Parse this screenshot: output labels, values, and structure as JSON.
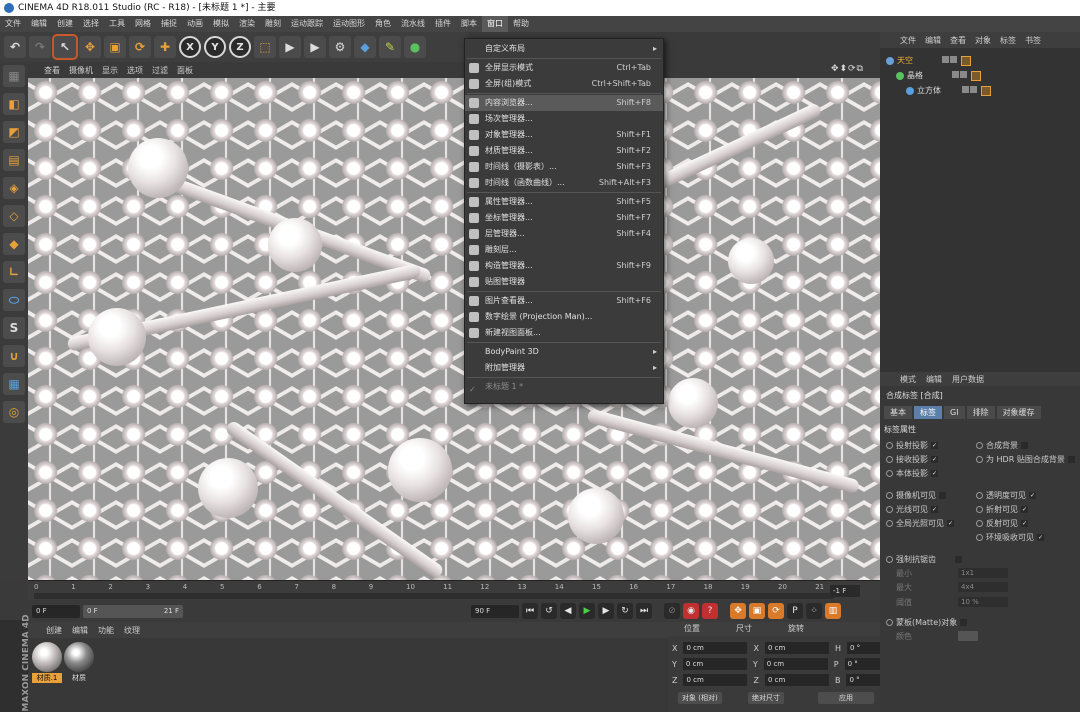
{
  "titlebar": {
    "title": "CINEMA 4D R18.011 Studio (RC - R18) - [未标题 1 *] - 主要"
  },
  "menubar": [
    "文件",
    "编辑",
    "创建",
    "选择",
    "工具",
    "网格",
    "捕捉",
    "动画",
    "模拟",
    "渲染",
    "雕刻",
    "运动跟踪",
    "运动图形",
    "角色",
    "流水线",
    "插件",
    "脚本",
    "窗口",
    "帮助"
  ],
  "menubar_active": "窗口",
  "toolbar": {
    "icons": [
      "undo-icon",
      "redo-icon",
      "select-icon",
      "move-icon",
      "scale-icon",
      "rotate-icon",
      "add-icon",
      "x-axis-icon",
      "y-axis-icon",
      "z-axis-icon",
      "coord-icon",
      "render-view-icon",
      "render-icon",
      "render-settings-icon",
      "cube-icon",
      "pen-icon",
      "object-icon"
    ],
    "x": "X",
    "y": "Y",
    "z": "Z"
  },
  "viewport_menu": [
    "查看",
    "摄像机",
    "显示",
    "选项",
    "过滤",
    "面板"
  ],
  "viewport_nav": "✥⬍⟳⧉",
  "window_menu": [
    {
      "label": "自定义布局",
      "shortcut": "",
      "arrow": true,
      "icon": false
    },
    {
      "label": "全屏显示模式",
      "shortcut": "Ctrl+Tab",
      "icon": true
    },
    {
      "label": "全屏(组)模式",
      "shortcut": "Ctrl+Shift+Tab",
      "icon": true
    },
    {
      "label": "内容浏览器...",
      "shortcut": "Shift+F8",
      "icon": true,
      "highlight": true
    },
    {
      "label": "场次管理器...",
      "shortcut": "",
      "icon": true
    },
    {
      "label": "对象管理器...",
      "shortcut": "Shift+F1",
      "icon": true
    },
    {
      "label": "材质管理器...",
      "shortcut": "Shift+F2",
      "icon": true
    },
    {
      "label": "时间线（摄影表）...",
      "shortcut": "Shift+F3",
      "icon": true
    },
    {
      "label": "时间线（函数曲线）...",
      "shortcut": "Shift+Alt+F3",
      "icon": true
    },
    {
      "label": "属性管理器...",
      "shortcut": "Shift+F5",
      "icon": true
    },
    {
      "label": "坐标管理器...",
      "shortcut": "Shift+F7",
      "icon": true
    },
    {
      "label": "层管理器...",
      "shortcut": "Shift+F4",
      "icon": true
    },
    {
      "label": "雕刻层...",
      "shortcut": "",
      "icon": true
    },
    {
      "label": "构造管理器...",
      "shortcut": "Shift+F9",
      "icon": true
    },
    {
      "label": "贴图管理器",
      "shortcut": "",
      "icon": true
    },
    {
      "label": "图片查看器...",
      "shortcut": "Shift+F6",
      "icon": true
    },
    {
      "label": "数字绘景 (Projection Man)...",
      "shortcut": "",
      "icon": true
    },
    {
      "label": "新建视图面板...",
      "shortcut": "",
      "icon": true
    },
    {
      "label": "BodyPaint 3D",
      "shortcut": "",
      "arrow": true,
      "icon": false
    },
    {
      "label": "附加管理器",
      "shortcut": "",
      "arrow": true,
      "icon": false
    },
    {
      "label": "未标题 1 *",
      "shortcut": "",
      "icon": false,
      "check": true,
      "disabled": true
    }
  ],
  "timeline": {
    "ticks": [
      "0",
      "1",
      "2",
      "3",
      "4",
      "5",
      "6",
      "7",
      "8",
      "9",
      "10",
      "11",
      "12",
      "13",
      "14",
      "15",
      "16",
      "17",
      "18",
      "19",
      "20",
      "21"
    ],
    "frame": "-1 F"
  },
  "transport": {
    "start": "0 F",
    "current": "0 F",
    "end_mark": "21 F",
    "end": "90 F"
  },
  "material_panel": {
    "menu": [
      "创建",
      "编辑",
      "功能",
      "纹理"
    ],
    "materials": [
      {
        "name": "材质.1",
        "selected": true
      },
      {
        "name": "材质",
        "selected": false
      }
    ],
    "brand": "MAXON CINEMA 4D"
  },
  "coord_panel": {
    "headers": [
      "位置",
      "尺寸",
      "旋转"
    ],
    "rows": [
      {
        "axis": "X",
        "pos": "0 cm",
        "size_axis": "X",
        "size": "0 cm",
        "rot_axis": "H",
        "rot": "0 °"
      },
      {
        "axis": "Y",
        "pos": "0 cm",
        "size_axis": "Y",
        "size": "0 cm",
        "rot_axis": "P",
        "rot": "0 °"
      },
      {
        "axis": "Z",
        "pos": "0 cm",
        "size_axis": "Z",
        "size": "0 cm",
        "rot_axis": "B",
        "rot": "0 °"
      }
    ],
    "mode": "对象 (相对)",
    "size_mode": "绝对尺寸",
    "apply": "应用"
  },
  "object_panel": {
    "menu": [
      "文件",
      "编辑",
      "查看",
      "对象",
      "标签",
      "书签"
    ],
    "objects": [
      {
        "name": "天空",
        "highlight": true
      },
      {
        "name": "晶格",
        "highlight": false
      },
      {
        "name": "立方体",
        "highlight": false
      }
    ]
  },
  "attr_panel": {
    "menu": [
      "模式",
      "编辑",
      "用户数据"
    ],
    "title": "合成标签 [合成]",
    "tabs": [
      "基本",
      "标签",
      "GI",
      "排除",
      "对象缓存"
    ],
    "active_tab": "标签",
    "section": "标签属性",
    "opts_a": [
      {
        "label": "投射投影",
        "checked": true
      },
      {
        "label": "接收投影",
        "checked": true
      },
      {
        "label": "本体投影",
        "checked": true
      }
    ],
    "opts_b": [
      {
        "label": "合成背景",
        "checked": false
      },
      {
        "label": "为 HDR 贴图合成背景",
        "checked": false
      }
    ],
    "opts_c": [
      {
        "label": "摄像机可见",
        "checked": false
      },
      {
        "label": "光线可见",
        "checked": true
      },
      {
        "label": "全局光照可见",
        "checked": true
      }
    ],
    "opts_d": [
      {
        "label": "透明度可见",
        "checked": true
      },
      {
        "label": "折射可见",
        "checked": true
      },
      {
        "label": "反射可见",
        "checked": true
      },
      {
        "label": "环境吸收可见",
        "checked": true
      }
    ],
    "force": "强制抗锯齿",
    "min": "最小",
    "min_val": "1x1",
    "max": "最大",
    "max_val": "4x4",
    "thresh": "阈值",
    "thresh_val": "10 %",
    "matte": "蒙板(Matte)对象",
    "color": "颜色"
  }
}
